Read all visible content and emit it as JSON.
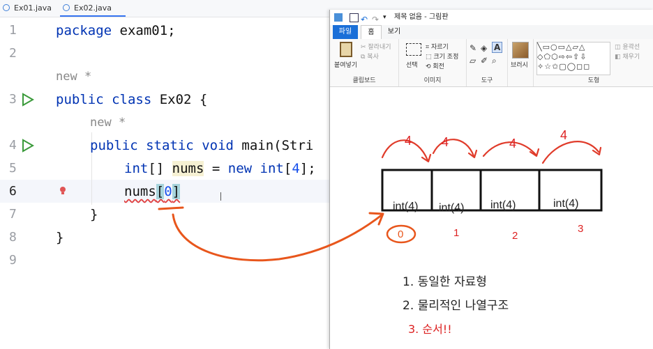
{
  "tabs": [
    {
      "label": "Ex01.java",
      "active": false
    },
    {
      "label": "Ex02.java",
      "active": true
    }
  ],
  "editor": {
    "line_numbers": [
      "1",
      "2",
      "3",
      "4",
      "5",
      "6",
      "7",
      "8",
      "9"
    ],
    "inlay_hint_class": "new *",
    "inlay_hint_method": "new *",
    "line1": {
      "kw": "package",
      "rest": " exam01;"
    },
    "line3": {
      "kw1": "public",
      "kw2": "class",
      "rest": " Ex02 {"
    },
    "line4": {
      "kw1": "public",
      "kw2": "static",
      "kw3": "void",
      "rest": " main(Stri"
    },
    "line5": {
      "kw1": "int",
      "p1": "[] ",
      "var": "nums",
      "p2": " = ",
      "kw2": "new",
      "p3": " ",
      "kw3": "int",
      "p4": "[",
      "num": "4",
      "p5": "];"
    },
    "line6": {
      "p1": "nums",
      "ob": "[",
      "num": "0",
      "cb": "]"
    },
    "line7": "}",
    "line8": "}"
  },
  "paint": {
    "title": "제목 없음 - 그림판",
    "menu": {
      "file": "파일",
      "home": "홈",
      "view": "보기"
    },
    "ribbon": {
      "clipboard": {
        "paste": "붙여넣기",
        "cut": "잘라내기",
        "copy": "복사",
        "label": "클립보드"
      },
      "image": {
        "select": "선택",
        "crop": "자르기",
        "resize": "크기 조정",
        "rotate": "회전",
        "label": "이미지"
      },
      "tools": {
        "label": "도구"
      },
      "brushes": {
        "label": "브러시"
      },
      "shapes": {
        "outline": "윤곽선",
        "fill": "채우기",
        "label": "도형"
      }
    },
    "canvas": {
      "cells": [
        "int(4)",
        "int(4)",
        "int(4)",
        "int(4)"
      ],
      "arrow_labels": [
        "4",
        "4",
        "4",
        "4"
      ],
      "indices": [
        "0",
        "1",
        "2",
        "3"
      ],
      "notes": [
        "1. 동일한 자료형",
        "2. 물리적인 나열구조",
        "3. 순서!!"
      ]
    }
  },
  "colors": {
    "keyword": "#0033b3",
    "number": "#1750eb",
    "annotation": "#e8561c",
    "red_ink": "#d22222"
  }
}
